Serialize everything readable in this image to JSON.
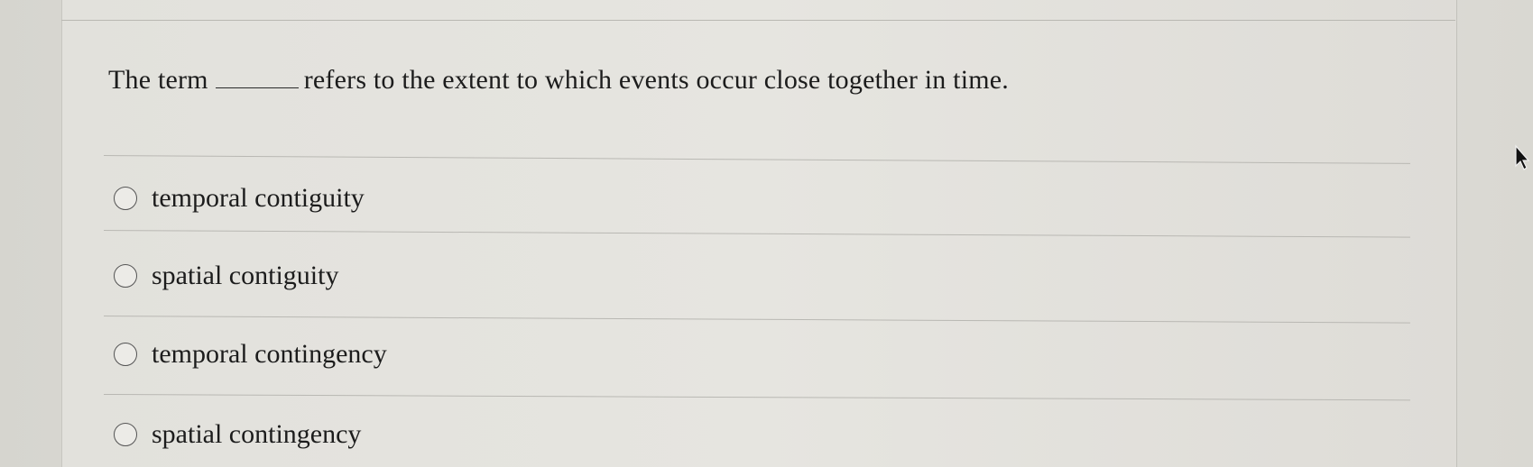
{
  "question": {
    "before_blank": "The term",
    "blank": "_____",
    "after_blank": "refers to the extent to which events occur close together in time."
  },
  "options": [
    {
      "label": "temporal contiguity",
      "selected": false
    },
    {
      "label": "spatial contiguity",
      "selected": false
    },
    {
      "label": "temporal contingency",
      "selected": false
    },
    {
      "label": "spatial contingency",
      "selected": false
    }
  ],
  "icons": {
    "cursor": "mouse-pointer-icon",
    "radio": "radio-button-icon"
  }
}
